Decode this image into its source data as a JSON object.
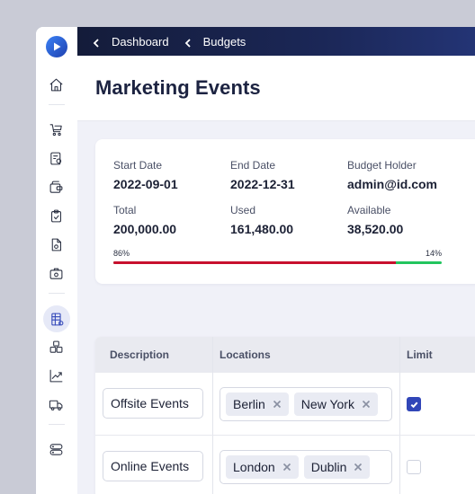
{
  "breadcrumb": {
    "items": [
      "Dashboard",
      "Budgets"
    ]
  },
  "page": {
    "title": "Marketing Events"
  },
  "summary": {
    "start_date": {
      "label": "Start Date",
      "value": "2022-09-01"
    },
    "end_date": {
      "label": "End Date",
      "value": "2022-12-31"
    },
    "budget_holder": {
      "label": "Budget Holder",
      "value": "admin@id.com"
    },
    "total": {
      "label": "Total",
      "value": "200,000.00"
    },
    "used": {
      "label": "Used",
      "value": "161,480.00"
    },
    "available": {
      "label": "Available",
      "value": "38,520.00"
    },
    "progress": {
      "used_label": "86%",
      "available_label": "14%",
      "used_fraction": 0.86,
      "used_color": "#c8102e",
      "available_color": "#22c55e"
    }
  },
  "table": {
    "headers": {
      "description": "Description",
      "locations": "Locations",
      "limit": "Limit"
    },
    "rows": [
      {
        "description": "Offsite Events",
        "locations": [
          "Berlin",
          "New York"
        ],
        "limit": true
      },
      {
        "description": "Online Events",
        "locations": [
          "London",
          "Dublin"
        ],
        "limit": false
      }
    ]
  },
  "sidebar": {
    "icons": [
      "home-icon",
      "cart-icon",
      "receipt-icon",
      "wallet-icon",
      "clipboard-check-icon",
      "document-icon",
      "briefcase-icon",
      "budget-table-icon",
      "boxes-icon",
      "trend-chart-icon",
      "truck-icon",
      "server-icon"
    ],
    "active": "budget-table-icon"
  },
  "colors": {
    "accent": "#3146b8",
    "topbar": "#1b2757"
  }
}
